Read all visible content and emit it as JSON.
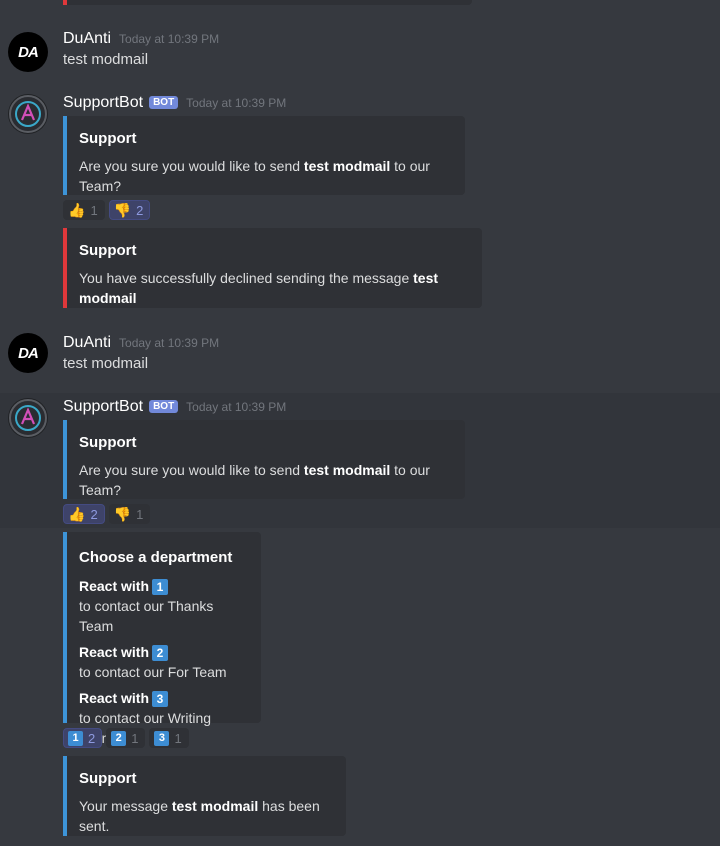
{
  "messages": [
    {
      "author": "DuAnti",
      "avatar_text": "DA",
      "timestamp": "Today at 10:39 PM",
      "text": "test modmail"
    },
    {
      "author": "SupportBot",
      "bot_tag": "BOT",
      "timestamp": "Today at 10:39 PM",
      "embed": {
        "title": "Support",
        "pre": "Are you sure you would like to send ",
        "bold": "test modmail",
        "post": " to our Team?"
      },
      "reactions": [
        {
          "emoji": "👍",
          "count": "1"
        },
        {
          "emoji": "👎",
          "count": "2"
        }
      ],
      "embed2": {
        "title": "Support",
        "pre": "You have successfully declined sending the message ",
        "bold": "test modmail"
      }
    },
    {
      "author": "DuAnti",
      "avatar_text": "DA",
      "timestamp": "Today at 10:39 PM",
      "text": "test modmail"
    },
    {
      "author": "SupportBot",
      "bot_tag": "BOT",
      "timestamp": "Today at 10:39 PM",
      "embed": {
        "title": "Support",
        "pre": "Are you sure you would like to send ",
        "bold": "test modmail",
        "post": " to our Team?"
      },
      "reactions": [
        {
          "emoji": "👍",
          "count": "2"
        },
        {
          "emoji": "👎",
          "count": "1"
        }
      ],
      "department": {
        "title": "Choose a department",
        "options": [
          {
            "react": "React with",
            "key": "1",
            "text": "to contact our Thanks Team"
          },
          {
            "react": "React with",
            "key": "2",
            "text": "to contact our For Team"
          },
          {
            "react": "React with",
            "key": "3",
            "text": "to contact our Writing Team"
          }
        ],
        "reactions": [
          {
            "key": "1",
            "count": "2"
          },
          {
            "key": "2",
            "count": "1"
          },
          {
            "key": "3",
            "count": "1"
          }
        ]
      },
      "final": {
        "title": "Support",
        "pre": "Your message ",
        "bold": "test modmail",
        "post": " has been sent."
      }
    }
  ],
  "colors": {
    "background": "#36393f",
    "embed_bg": "#2f3136",
    "accent_blue": "#3d94d8",
    "accent_red": "#e0383b",
    "bot_tag": "#7289da"
  }
}
